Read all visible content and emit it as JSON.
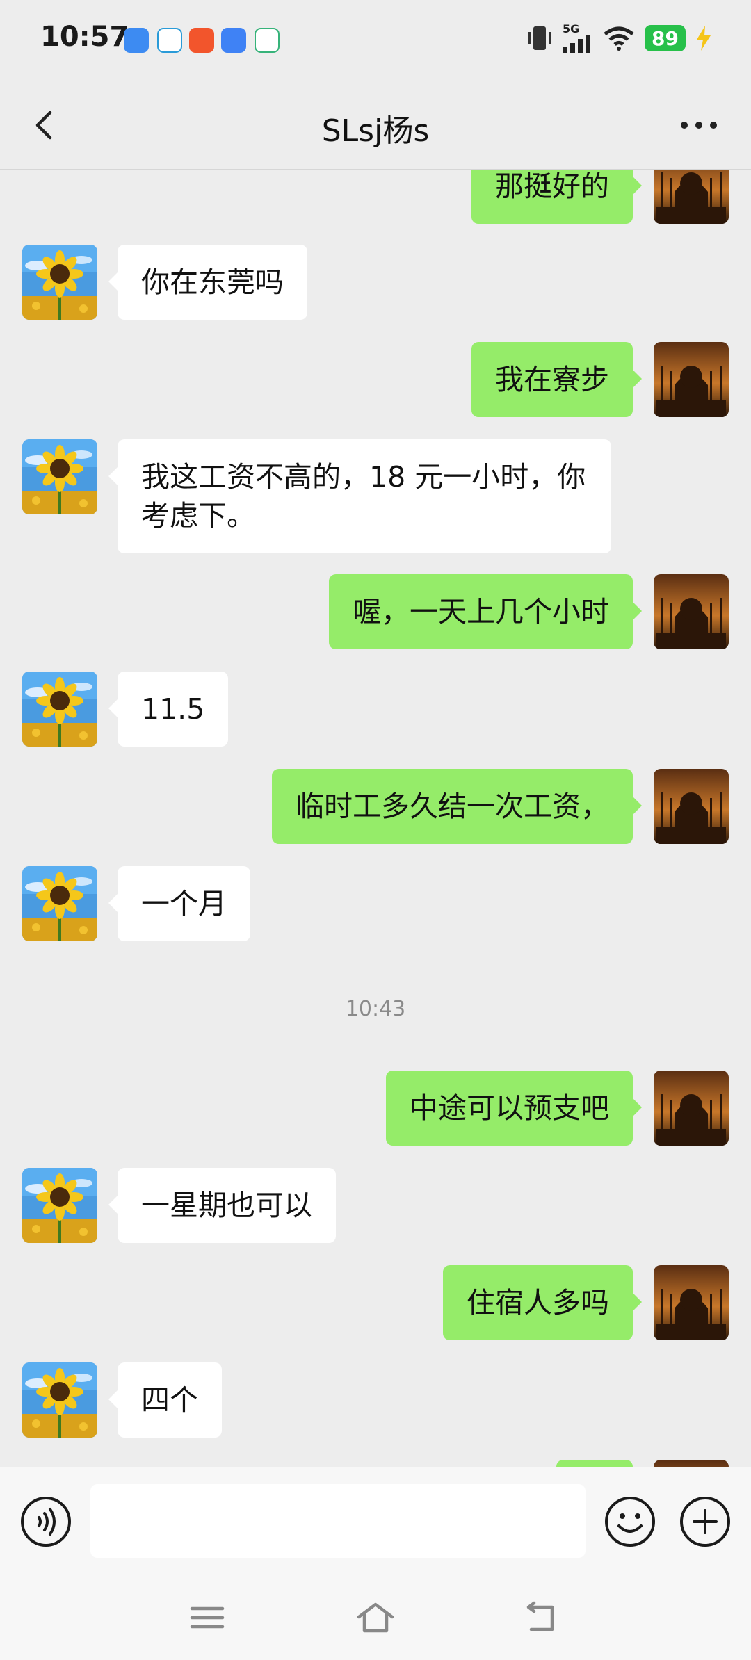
{
  "status_bar": {
    "time": "10:57",
    "network": "5G",
    "battery": "89",
    "icons": [
      "vibrate-icon",
      "signal-icon",
      "wifi-icon",
      "charging-icon"
    ],
    "notification_icons": [
      "app-notification-blue",
      "app-notification-teal",
      "app-notification-orange",
      "app-notification-sky",
      "app-notification-green"
    ]
  },
  "header": {
    "title": "SLsj杨s",
    "back_icon": "chevron-left-icon",
    "more_icon": "more-dots-icon"
  },
  "messages": [
    {
      "side": "right",
      "text": "那挺好的"
    },
    {
      "side": "left",
      "text": "你在东莞吗"
    },
    {
      "side": "right",
      "text": "我在寮步"
    },
    {
      "side": "left",
      "text": "我这工资不高的，18 元一小时，你考虑下。"
    },
    {
      "side": "right",
      "text": "喔，一天上几个小时"
    },
    {
      "side": "left",
      "text": "11.5"
    },
    {
      "side": "right",
      "text": "临时工多久结一次工资，"
    },
    {
      "side": "left",
      "text": "一个月"
    },
    {
      "timestamp": "10:43"
    },
    {
      "side": "right",
      "text": "中途可以预支吧"
    },
    {
      "side": "left",
      "text": "一星期也可以"
    },
    {
      "side": "right",
      "text": "住宿人多吗"
    },
    {
      "side": "left",
      "text": "四个"
    }
  ],
  "input_bar": {
    "voice_icon": "voice-input-icon",
    "emoji_icon": "emoji-icon",
    "plus_icon": "plus-icon",
    "text_value": ""
  },
  "nav_bar": {
    "icons": [
      "menu-icon",
      "home-icon",
      "back-icon"
    ]
  },
  "colors": {
    "background": "#EDEDED",
    "sent_bubble": "#95EC69",
    "received_bubble": "#FFFFFF",
    "battery": "#27C04A"
  }
}
